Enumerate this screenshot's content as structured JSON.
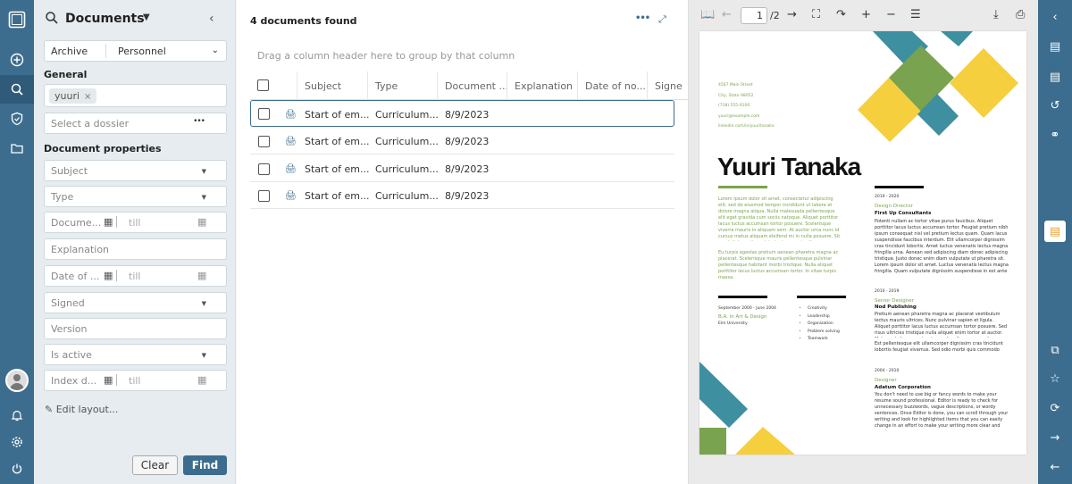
{
  "panel": {
    "title": "Documents",
    "archive_label": "Archive",
    "archive_value": "Personnel",
    "general_label": "General",
    "search_chip": "yuuri",
    "dossier_placeholder": "Select a dossier",
    "dossier_more": "•••",
    "props_label": "Document properties",
    "subject": "Subject",
    "type": "Type",
    "document_date": "Docume...",
    "till": "till",
    "explanation": "Explanation",
    "date_of": "Date of ...",
    "signed": "Signed",
    "version": "Version",
    "is_active": "Is active",
    "index_date": "Index d...",
    "edit_layout": "Edit layout...",
    "clear": "Clear",
    "find": "Find"
  },
  "grid": {
    "found": "4 documents found",
    "drag_hint": "Drag a column header here to group by that column",
    "columns": [
      "Subject",
      "Type",
      "Document ...",
      "Explanation",
      "Date of no...",
      "Signe"
    ],
    "rows": [
      {
        "subject": "Start of em...",
        "type": "Curriculum...",
        "date": "8/9/2023"
      },
      {
        "subject": "Start of em...",
        "type": "Curriculum...",
        "date": "8/9/2023"
      },
      {
        "subject": "Start of em...",
        "type": "Curriculum...",
        "date": "8/9/2023"
      },
      {
        "subject": "Start of em...",
        "type": "Curriculum...",
        "date": "8/9/2023"
      }
    ]
  },
  "viewer": {
    "page": "1",
    "page_count": "/2",
    "colors": {
      "teal": "#3e8fa0",
      "green": "#7aa34f",
      "yellow": "#f5cf3e"
    },
    "resume": {
      "address": [
        "4567 Main Street",
        "City, State 98052",
        "(718) 555-0100",
        "yuuri@example.com",
        "linkedin.com/in/yuuritanaka"
      ],
      "name": "Yuuri Tanaka",
      "intro1": "Lorem ipsum dolor sit amet, consectetur adipiscing elit, sed do eiusmod tempor incididunt ut labore et dolore magna aliqua. Nulla malesuada pellentesque elit eget gravida cum sociis natoque. Aliquet porttitor lacus luctus accumsan tortor posuere. Scelerisque viverra mauris in aliquam sem. At auctor urna nunc id cursus metus aliquam eleifend mi in nulla posuere. Sit amet dictum sit amet justo donec enim diam vulputate. Fermentum leo vel orci porta non pulvinar neque. Feugiat in ante metus dictum at tempor commodo ullamcorper. Porttitor leo a diam sollicitudin tempor id eu nisl nunc. Tempor nec feugiat nisl pretium fusce id velit ut tortor. Facilisi etiam dignissim diam quis enim lobortis scelerisque fermentum dui. Ac tortor vitae purus faucibus ornare suspendisse sed nisi lacus. Amet aliquam id diam maecenas ultricies mi eget mauris pharetra.",
      "intro2": "Eu turpis egestas pretium aenean pharetra magna ac placerat. Scelerisque mauris pellentesque pulvinar pellentesque habitant morbi tristique. Nulla aliquet porttitor lacus luctus accumsan tortor. In vitae turpis massa.",
      "edu_date": "September 2000 - June 2004",
      "edu_degree": "B.A. in Art & Design",
      "edu_school": "Elm University",
      "skills": [
        "Creativity",
        "Leadership",
        "Organization",
        "Problem solving",
        "Teamwork"
      ],
      "jobs": [
        {
          "dates": "2019 - 2020",
          "title": "Design Director",
          "company": "First Up Consultants",
          "text": "Potenti nullam ac tortor vitae purus faucibus. Aliquet porttitor lacus luctus accumsan tortor. Feugiat pretium nibh ipsum consequat nisl vel pretium lectus quam. Quam lacus suspendisse faucibus interdum. Elit ullamcorper dignissim cras tincidunt lobortis. Amet luctus venenatis lectus magna fringilla urna. Aenean sed adipiscing diam donec adipiscing tristique. Justo donec enim diam vulputate ut pharetra sit. Lorem ipsum dolor sit amet. Luctus venenatis lectus magna fringilla. Quam vulputate dignissim suspendisse in est ante in nibh mauris. Mattis rhoncus urna neque viverra justo nec ultrices dui sapien. Vestibulum lorem sed risus ultricies tristique nulla aliquet enim tortor. Aliquam vestibulum morbi blandit cursus risus at ultrices mi tempus. Diam quis enim lobortis scelerisque fermentum dui faucibus in ornare. Pharetra convallis posuere morbi leo urna molestie at. Quam nulla porttitor massa id neque aliquam vestibulum. Cras fermentum odio eu feugiat pretium nibh ipsum consequat nisl. Nec ultrices dui sapien eget mi proin sed libero. Donec et odio pellentesque diam volutpat commodo sed egestas egestas. Egestas maecenas pharetra convallis posuere morbi leo urna."
        },
        {
          "dates": "2010 - 2019",
          "title": "Senior Designer",
          "company": "Nod Publishing",
          "text": "Pretium aenean pharetra magna ac placerat vestibulum lectus mauris ultrices. Nunc pulvinar sapien et ligula. Aliquet porttitor lacus luctus accumsan tortor posuere. Sed risus ultricies tristique nulla aliquet enim tortor at auctor. Malesuada fames ac turpis egestas. Arcu cursus vitae congue mauris rhoncus aenean vel elit. Dignissim diam quis enim lobortis scelerisque fermentum. Amet nulla facilisi morbi tempus iaculis urna id volutpat lacus. Vitae proin sagittis nisl rhoncus mattis rhoncus urna neque. Quis varius quam quisque id diam vel quam elementum. Mi sit amet mauris commodo quis imperdiet massa tincidunt nunc. Tellus elementum sagittis vitae et leo duis ut diam quam.",
          "text2": "Est pellentesque elit ullamcorper dignissim cras tincidunt lobortis feugiat vivamus. Sed odio morbi quis commodo odio aenean sed adipiscing diam. Vestibulum mattis ullamcorper velit sed ullamcorper morbi tincidunt ornare massa. Sem fringilla ut morbi tincidunt augue interdum velit euismod in. Condimentum mattis pellentesque id nibh tortor id aliquet lectus proin. Ac ut consequat semper viverra nam libero justo laoreet sit."
        },
        {
          "dates": "2004 - 2010",
          "title": "Designer",
          "company": "Adatum Corporation",
          "text": "You don't need to use big or fancy words to make your resume sound professional. Editor is ready to check for unnecessary buzzwords, vague descriptions, or wordy sentences. Once Editor is done, you can scroll through your writing and look for highlighted items that you can easily change in an effort to make your writing more clear and concise."
        }
      ]
    }
  }
}
